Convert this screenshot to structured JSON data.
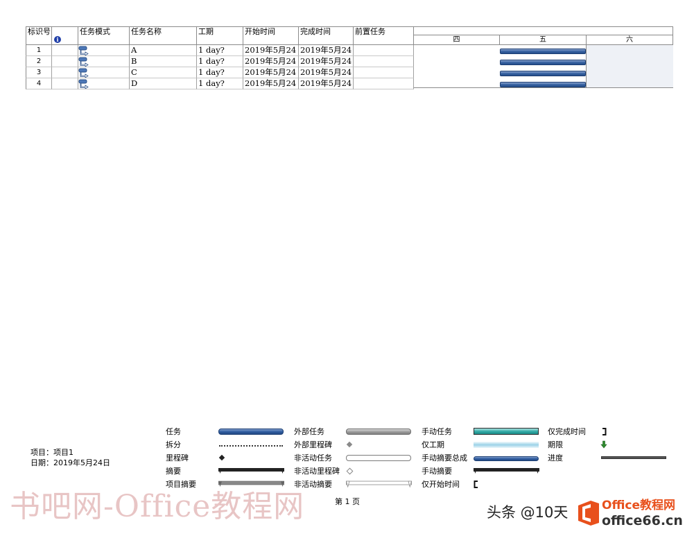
{
  "table": {
    "headers": {
      "id": "标识号",
      "mode": "任务模式",
      "name": "任务名称",
      "duration": "工期",
      "start": "开始时间",
      "finish": "完成时间",
      "predecessors": "前置任务"
    },
    "info_icon": "i",
    "rows": [
      {
        "id": "1",
        "name": "A",
        "duration": "1 day?",
        "start": "2019年5月24",
        "finish": "2019年5月24",
        "predecessors": ""
      },
      {
        "id": "2",
        "name": "B",
        "duration": "1 day?",
        "start": "2019年5月24",
        "finish": "2019年5月24",
        "predecessors": ""
      },
      {
        "id": "3",
        "name": "C",
        "duration": "1 day?",
        "start": "2019年5月24",
        "finish": "2019年5月24",
        "predecessors": ""
      },
      {
        "id": "4",
        "name": "D",
        "duration": "1 day?",
        "start": "2019年5月24",
        "finish": "2019年5月24",
        "predecessors": ""
      }
    ]
  },
  "gantt": {
    "days": [
      "四",
      "五",
      "六"
    ]
  },
  "footer": {
    "project_label": "项目：项目1",
    "date_label": "日期：2019年5月24日",
    "page_label": "第 1 页"
  },
  "legend": {
    "task": "任务",
    "split": "拆分",
    "milestone": "里程碑",
    "summary": "摘要",
    "project_summary": "项目摘要",
    "external_tasks": "外部任务",
    "external_milestone": "外部里程碑",
    "inactive_task": "非活动任务",
    "inactive_milestone": "非活动里程碑",
    "inactive_summary": "非活动摘要",
    "manual_task": "手动任务",
    "duration_only": "仅工期",
    "manual_summary_rollup": "手动摘要总成",
    "manual_summary": "手动摘要",
    "start_only": "仅开始时间",
    "finish_only": "仅完成时间",
    "deadline": "期限",
    "progress": "进度"
  },
  "watermarks": {
    "left": "书吧网-Office教程网",
    "right_handle": "头条 @10天",
    "logo_line1": "Office教程网",
    "logo_line2": "office66.cn"
  },
  "colors": {
    "task_bar": "#2d5a9e",
    "manual_task": "#2fa8a4",
    "weekend_shade": "#eef1f6",
    "deadline_arrow": "#2e8b2e",
    "watermark_red": "#d69696",
    "logo_orange": "#e8501c"
  }
}
